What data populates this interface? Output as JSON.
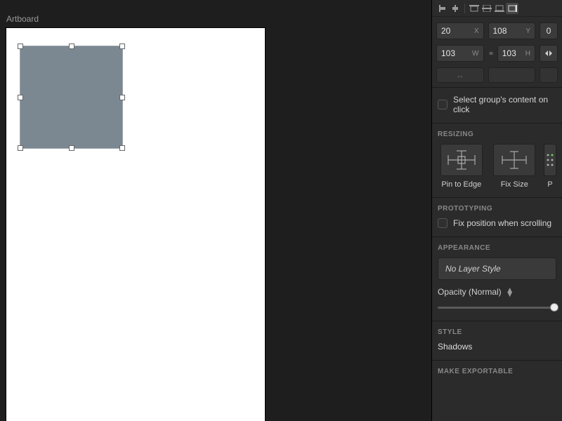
{
  "artboard": {
    "label": "Artboard"
  },
  "position": {
    "x": "20",
    "x_unit": "X",
    "y": "108",
    "y_unit": "Y",
    "extra": "0"
  },
  "size": {
    "w": "103",
    "w_unit": "W",
    "h": "103",
    "h_unit": "H"
  },
  "group_click": {
    "label": "Select group's content on click"
  },
  "resizing": {
    "title": "RESIZING",
    "pin": "Pin to Edge",
    "fix": "Fix Size",
    "third": "P"
  },
  "prototyping": {
    "title": "PROTOTYPING",
    "fix_scroll": "Fix position when scrolling"
  },
  "appearance": {
    "title": "APPEARANCE",
    "layer_style": "No Layer Style",
    "opacity_label": "Opacity (Normal)"
  },
  "style": {
    "title": "STYLE",
    "shadows": "Shadows"
  },
  "export": {
    "title": "MAKE EXPORTABLE"
  }
}
